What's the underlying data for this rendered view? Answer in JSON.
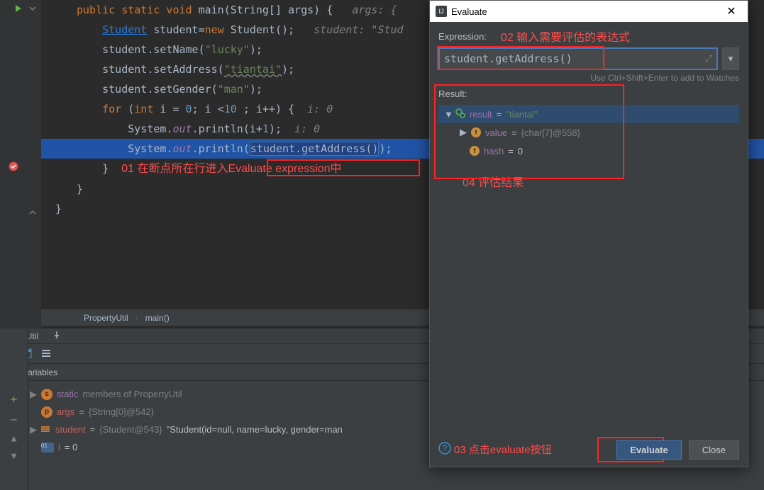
{
  "code": {
    "line1_pre": "public static void ",
    "line1_main": "main",
    "line1_paren": "(String[] args) {   ",
    "line1_hint": "args: {",
    "line2_type": "Student",
    "line2_mid": " student=",
    "line2_new": "new ",
    "line2_rest": "Student();   ",
    "line2_hint": "student: \"Stud",
    "line3_pre": "student.setName(",
    "line3_str": "\"lucky\"",
    "line3_post": ");",
    "line4_pre": "student.setAddress(",
    "line4_str": "\"tiantai\"",
    "line4_post": ");",
    "line5_pre": "student.setGender(",
    "line5_str": "\"man\"",
    "line5_post": ");",
    "line6_for": "for ",
    "line6_paren": "(",
    "line6_int": "int ",
    "line6_rest1": "i = ",
    "line6_zero": "0",
    "line6_rest2": "; i <",
    "line6_ten": "10 ",
    "line6_rest3": "; i++) {  ",
    "line6_hint": "i: 0",
    "line7_pre": "System.",
    "line7_out": "out",
    "line7_rest": ".println(i+",
    "line7_one": "1",
    "line7_post": ");  ",
    "line7_hint": "i: 0",
    "line8_pre": "System.",
    "line8_out": "out",
    "line8_mid": ".println(",
    "line8_sel": "student.getAddress()",
    "line8_post": ");",
    "line9": "}  ",
    "line10": "}",
    "line11": "}"
  },
  "annotations": {
    "a01": "01 在断点所在行进入Evaluate expression中",
    "a02": "02 输入需要评估的表达式",
    "a03": "03 点击evaluate按钮",
    "a04": "04 评估结果"
  },
  "breadcrumb": {
    "item1": "PropertyUtil",
    "item2": "main()"
  },
  "tabs": {
    "tab1": "pertyUtil"
  },
  "variables": {
    "header": "Variables",
    "row1_name": "static ",
    "row1_val": "members of PropertyUtil",
    "row2_name": "args",
    "row2_eq": " = ",
    "row2_val": "{String[0]@542}",
    "row3_name": "student",
    "row3_eq": " = ",
    "row3_val1": "{Student@543}",
    "row3_val2": " \"Student(id=null, name=lucky, gender=man",
    "row4_name": "i",
    "row4_val": " = 0"
  },
  "dialog": {
    "title": "Evaluate",
    "expression_label": "Expression:",
    "expression_value": "student.getAddress()",
    "hint": "Use Ctrl+Shift+Enter to add to Watches",
    "result_label": "Result:",
    "result_name": "result",
    "result_eq": " = ",
    "result_val": "\"tiantai\"",
    "value_name": "value",
    "value_eq": " = ",
    "value_val": "{char[7]@558}",
    "hash_name": "hash",
    "hash_eq": " = ",
    "hash_val": "0",
    "evaluate_btn": "Evaluate",
    "close_btn": "Close"
  }
}
